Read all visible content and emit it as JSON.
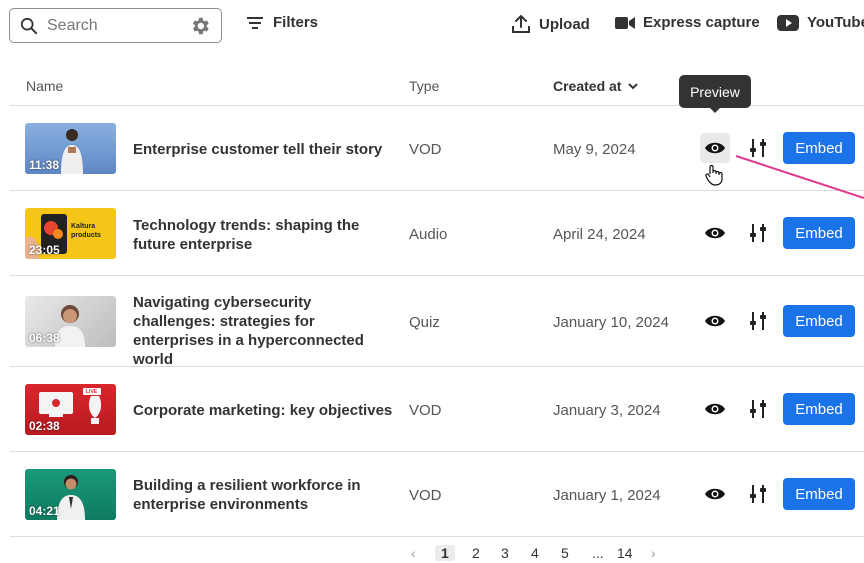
{
  "toolbar": {
    "search_placeholder": "Search",
    "filters_label": "Filters",
    "upload_label": "Upload",
    "express_label": "Express capture",
    "youtube_label": "YouTube"
  },
  "table": {
    "columns": [
      "Name",
      "Type",
      "Created at"
    ],
    "rows": [
      {
        "title": "Enterprise customer tell their story",
        "type": "VOD",
        "created": "May 9, 2024",
        "duration": "11:38",
        "embed": "Embed"
      },
      {
        "title": "Technology trends: shaping the future enterprise",
        "type": "Audio",
        "created": "April 24, 2024",
        "duration": "23:05",
        "embed": "Embed",
        "thumb_text": "Kaltura products"
      },
      {
        "title": "Navigating cybersecurity challenges: strategies for enterprises in a hyperconnected world",
        "type": "Quiz",
        "created": "January 10, 2024",
        "duration": "06:38",
        "embed": "Embed"
      },
      {
        "title": "Corporate marketing: key objectives",
        "type": "VOD",
        "created": "January 3, 2024",
        "duration": "02:38",
        "embed": "Embed",
        "thumb_text": "LIVE"
      },
      {
        "title": "Building a resilient workforce in enterprise environments",
        "type": "VOD",
        "created": "January 1, 2024",
        "duration": "04:21",
        "embed": "Embed"
      }
    ]
  },
  "tooltip": "Preview",
  "pagination": {
    "pages": [
      "1",
      "2",
      "3",
      "4",
      "5",
      "...",
      "14"
    ],
    "current": "1"
  },
  "colors": {
    "accent": "#1a73e8",
    "annotation_line": "#e0388b"
  }
}
